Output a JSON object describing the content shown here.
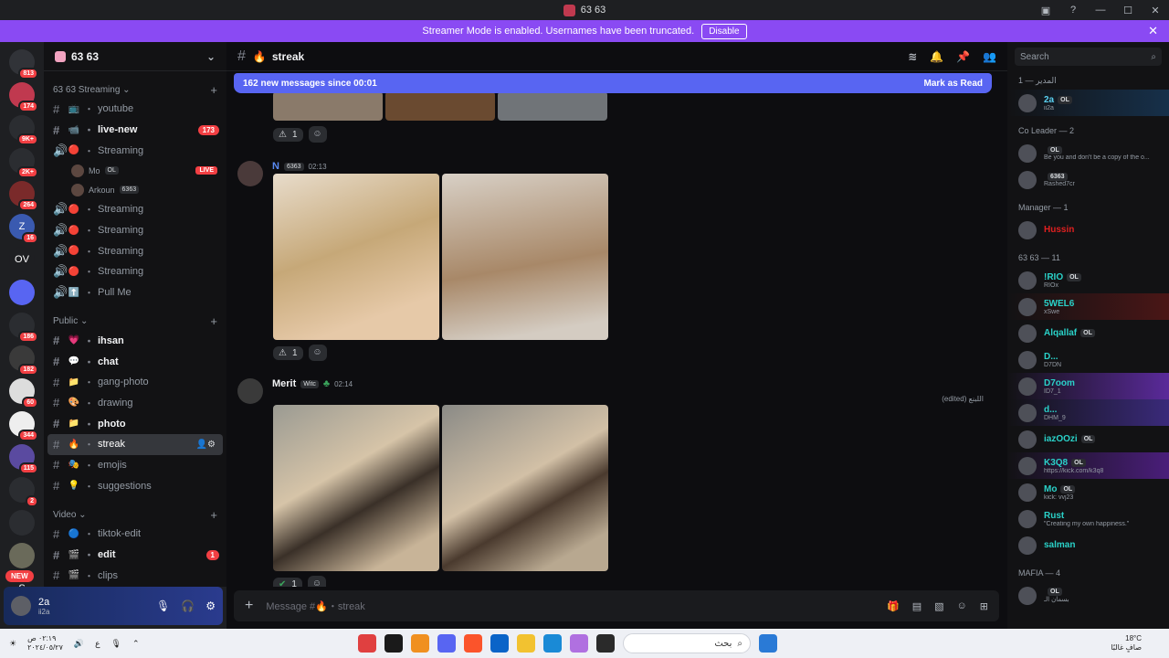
{
  "window": {
    "title": "63 63"
  },
  "banner": {
    "text": "Streamer Mode is enabled. Usernames have been truncated.",
    "button": "Disable"
  },
  "guilds": [
    {
      "label": "",
      "badge": "813",
      "color": "#313338"
    },
    {
      "label": "",
      "badge": "174",
      "color": "#c0394f"
    },
    {
      "label": "",
      "badge": "9K+",
      "color": "#2b2d31"
    },
    {
      "label": "",
      "badge": "2K+",
      "color": "#2b2d31"
    },
    {
      "label": "",
      "badge": "264",
      "color": "#7a2a2a"
    },
    {
      "label": "Z",
      "badge": "16",
      "color": "#3a5ab0"
    },
    {
      "label": "OV",
      "badge": "",
      "color": "#1e1f22"
    },
    {
      "label": "",
      "badge": "",
      "color": "#5865f2"
    },
    {
      "label": "",
      "badge": "186",
      "color": "#2b2d31"
    },
    {
      "label": "",
      "badge": "182",
      "color": "#3a3a3a"
    },
    {
      "label": "",
      "badge": "60",
      "color": "#ddd"
    },
    {
      "label": "",
      "badge": "344",
      "color": "#eee"
    },
    {
      "label": "",
      "badge": "115",
      "color": "#5a4aa0"
    },
    {
      "label": "",
      "badge": "2",
      "color": "#2b2d31"
    },
    {
      "label": "",
      "badge": "",
      "color": "#2b2d31"
    },
    {
      "label": "",
      "badge": "",
      "color": "#6a6a5a"
    },
    {
      "label": "S",
      "badge": "26",
      "color": "#1e1f22"
    }
  ],
  "new_badge": "NEW",
  "server": {
    "name": "63 63"
  },
  "categories": {
    "streaming": "63 63 Streaming",
    "public": "Public",
    "video": "Video"
  },
  "channels_streaming": [
    {
      "emoji": "📺",
      "name": "youtube",
      "unread": false,
      "count": ""
    },
    {
      "emoji": "📹",
      "name": "live-new",
      "unread": true,
      "count": "173"
    },
    {
      "emoji": "🔴",
      "name": "Streaming",
      "unread": false,
      "count": "",
      "voice": true
    }
  ],
  "voice_users": [
    {
      "name": "Mo",
      "tag": "OL",
      "live": "LIVE"
    },
    {
      "name": "Arkoun",
      "tag": "6363",
      "live": ""
    }
  ],
  "channels_streaming2": [
    {
      "emoji": "🔴",
      "name": "Streaming"
    },
    {
      "emoji": "🔴",
      "name": "Streaming"
    },
    {
      "emoji": "🔴",
      "name": "Streaming"
    },
    {
      "emoji": "🔴",
      "name": "Streaming"
    },
    {
      "emoji": "⬆️",
      "name": "Pull Me"
    }
  ],
  "channels_public": [
    {
      "emoji": "💗",
      "name": "ihsan",
      "unread": true
    },
    {
      "emoji": "💬",
      "name": "chat",
      "unread": true
    },
    {
      "emoji": "📁",
      "name": "gang-photo",
      "unread": false
    },
    {
      "emoji": "🎨",
      "name": "drawing",
      "unread": false
    },
    {
      "emoji": "📁",
      "name": "photo",
      "unread": true
    },
    {
      "emoji": "🔥",
      "name": "streak",
      "unread": false,
      "selected": true
    },
    {
      "emoji": "🎭",
      "name": "emojis",
      "unread": false
    },
    {
      "emoji": "💡",
      "name": "suggestions",
      "unread": false
    }
  ],
  "channels_video": [
    {
      "emoji": "🔵",
      "name": "tiktok-edit",
      "unread": false,
      "count": ""
    },
    {
      "emoji": "🎬",
      "name": "edit",
      "unread": true,
      "count": "1"
    },
    {
      "emoji": "🎬",
      "name": "clips",
      "unread": false,
      "count": ""
    }
  ],
  "user": {
    "name": "2a",
    "status": "ii2a"
  },
  "chat": {
    "channel": "streak",
    "newbar": "162 new messages since 00:01",
    "mark_read": "Mark as Read",
    "messages": [
      {
        "author": "N",
        "tag": "6363",
        "time": "02:13",
        "reaction": "1"
      },
      {
        "author": "Merit",
        "tag": "Witc",
        "time": "02:14",
        "reaction": "1",
        "edited": "(edited) اللبنع"
      }
    ],
    "top_reaction": "1",
    "composer_placeholder": "Message #🔥・streak"
  },
  "members": {
    "search_placeholder": "Search",
    "groups": [
      {
        "title": "المدير — 1",
        "items": [
          {
            "name": "2a",
            "status": "ii2a",
            "color": "#5ad1f2",
            "bg": "bg1",
            "tag": "OL"
          }
        ]
      },
      {
        "title": "Co Leader — 2",
        "items": [
          {
            "name": "",
            "status": "Be you and don't be a copy of the o...",
            "color": "#f2f3f5",
            "bg": "",
            "tag": "OL"
          },
          {
            "name": "",
            "status": "Rashed7cr",
            "color": "#f2f3f5",
            "bg": "",
            "tag": "6363"
          }
        ]
      },
      {
        "title": "Manager — 1",
        "items": [
          {
            "name": "Hussin",
            "status": "",
            "color": "#e02020",
            "bg": "",
            "tag": ""
          }
        ]
      },
      {
        "title": "63 63 — 11",
        "items": [
          {
            "name": "!RIO",
            "status": "RIOx",
            "color": "#2ad2c9",
            "bg": "",
            "tag": "OL"
          },
          {
            "name": "5WEL6",
            "status": "xSwe",
            "color": "#2ad2c9",
            "bg": "bg2",
            "tag": ""
          },
          {
            "name": "Alqallaf",
            "status": "",
            "color": "#2ad2c9",
            "bg": "",
            "tag": "OL"
          },
          {
            "name": "D...",
            "status": "D7DN",
            "color": "#2ad2c9",
            "bg": "",
            "tag": ""
          },
          {
            "name": "D7oom",
            "status": "ID7_1",
            "color": "#2ad2c9",
            "bg": "bg3",
            "tag": ""
          },
          {
            "name": "d...",
            "status": "DHM_9",
            "color": "#2ad2c9",
            "bg": "bg4",
            "tag": ""
          },
          {
            "name": "iazOOzi",
            "status": "",
            "color": "#2ad2c9",
            "bg": "",
            "tag": "OL"
          },
          {
            "name": "K3Q8",
            "status": "https://kick.com/k3q8",
            "color": "#2ad2c9",
            "bg": "bg5",
            "tag": "OL"
          },
          {
            "name": "Mo",
            "status": "kick: vvj23",
            "color": "#2ad2c9",
            "bg": "",
            "tag": "OL"
          },
          {
            "name": "Rust",
            "status": "\"Creating my own happiness.\"",
            "color": "#2ad2c9",
            "bg": "",
            "tag": ""
          },
          {
            "name": "salman",
            "status": "",
            "color": "#2ad2c9",
            "bg": "",
            "tag": ""
          }
        ]
      },
      {
        "title": "MAFIA — 4",
        "items": [
          {
            "name": "",
            "status": "بسمان الـ",
            "color": "#f2f3f5",
            "bg": "",
            "tag": "OL"
          }
        ]
      }
    ]
  },
  "taskbar": {
    "time": "٠٢:١٩ ص",
    "date": "٢٠٢٤/٠٥/٢٧",
    "lang": "ع",
    "search": "بحث",
    "weather_temp": "18°C",
    "weather_desc": "صافٍ غالبًا"
  }
}
